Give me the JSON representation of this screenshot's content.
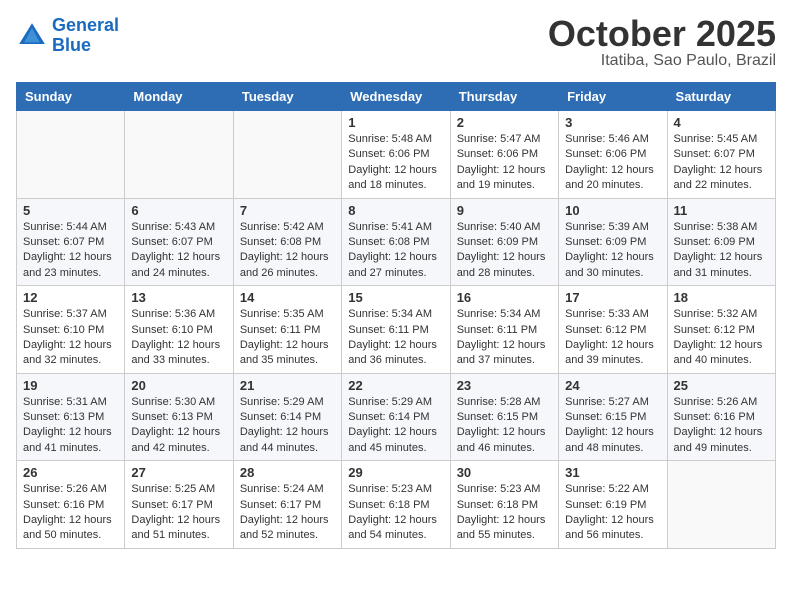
{
  "header": {
    "logo_line1": "General",
    "logo_line2": "Blue",
    "month": "October 2025",
    "location": "Itatiba, Sao Paulo, Brazil"
  },
  "weekdays": [
    "Sunday",
    "Monday",
    "Tuesday",
    "Wednesday",
    "Thursday",
    "Friday",
    "Saturday"
  ],
  "weeks": [
    [
      {
        "day": "",
        "sunrise": "",
        "sunset": "",
        "daylight": ""
      },
      {
        "day": "",
        "sunrise": "",
        "sunset": "",
        "daylight": ""
      },
      {
        "day": "",
        "sunrise": "",
        "sunset": "",
        "daylight": ""
      },
      {
        "day": "1",
        "sunrise": "Sunrise: 5:48 AM",
        "sunset": "Sunset: 6:06 PM",
        "daylight": "Daylight: 12 hours and 18 minutes."
      },
      {
        "day": "2",
        "sunrise": "Sunrise: 5:47 AM",
        "sunset": "Sunset: 6:06 PM",
        "daylight": "Daylight: 12 hours and 19 minutes."
      },
      {
        "day": "3",
        "sunrise": "Sunrise: 5:46 AM",
        "sunset": "Sunset: 6:06 PM",
        "daylight": "Daylight: 12 hours and 20 minutes."
      },
      {
        "day": "4",
        "sunrise": "Sunrise: 5:45 AM",
        "sunset": "Sunset: 6:07 PM",
        "daylight": "Daylight: 12 hours and 22 minutes."
      }
    ],
    [
      {
        "day": "5",
        "sunrise": "Sunrise: 5:44 AM",
        "sunset": "Sunset: 6:07 PM",
        "daylight": "Daylight: 12 hours and 23 minutes."
      },
      {
        "day": "6",
        "sunrise": "Sunrise: 5:43 AM",
        "sunset": "Sunset: 6:07 PM",
        "daylight": "Daylight: 12 hours and 24 minutes."
      },
      {
        "day": "7",
        "sunrise": "Sunrise: 5:42 AM",
        "sunset": "Sunset: 6:08 PM",
        "daylight": "Daylight: 12 hours and 26 minutes."
      },
      {
        "day": "8",
        "sunrise": "Sunrise: 5:41 AM",
        "sunset": "Sunset: 6:08 PM",
        "daylight": "Daylight: 12 hours and 27 minutes."
      },
      {
        "day": "9",
        "sunrise": "Sunrise: 5:40 AM",
        "sunset": "Sunset: 6:09 PM",
        "daylight": "Daylight: 12 hours and 28 minutes."
      },
      {
        "day": "10",
        "sunrise": "Sunrise: 5:39 AM",
        "sunset": "Sunset: 6:09 PM",
        "daylight": "Daylight: 12 hours and 30 minutes."
      },
      {
        "day": "11",
        "sunrise": "Sunrise: 5:38 AM",
        "sunset": "Sunset: 6:09 PM",
        "daylight": "Daylight: 12 hours and 31 minutes."
      }
    ],
    [
      {
        "day": "12",
        "sunrise": "Sunrise: 5:37 AM",
        "sunset": "Sunset: 6:10 PM",
        "daylight": "Daylight: 12 hours and 32 minutes."
      },
      {
        "day": "13",
        "sunrise": "Sunrise: 5:36 AM",
        "sunset": "Sunset: 6:10 PM",
        "daylight": "Daylight: 12 hours and 33 minutes."
      },
      {
        "day": "14",
        "sunrise": "Sunrise: 5:35 AM",
        "sunset": "Sunset: 6:11 PM",
        "daylight": "Daylight: 12 hours and 35 minutes."
      },
      {
        "day": "15",
        "sunrise": "Sunrise: 5:34 AM",
        "sunset": "Sunset: 6:11 PM",
        "daylight": "Daylight: 12 hours and 36 minutes."
      },
      {
        "day": "16",
        "sunrise": "Sunrise: 5:34 AM",
        "sunset": "Sunset: 6:11 PM",
        "daylight": "Daylight: 12 hours and 37 minutes."
      },
      {
        "day": "17",
        "sunrise": "Sunrise: 5:33 AM",
        "sunset": "Sunset: 6:12 PM",
        "daylight": "Daylight: 12 hours and 39 minutes."
      },
      {
        "day": "18",
        "sunrise": "Sunrise: 5:32 AM",
        "sunset": "Sunset: 6:12 PM",
        "daylight": "Daylight: 12 hours and 40 minutes."
      }
    ],
    [
      {
        "day": "19",
        "sunrise": "Sunrise: 5:31 AM",
        "sunset": "Sunset: 6:13 PM",
        "daylight": "Daylight: 12 hours and 41 minutes."
      },
      {
        "day": "20",
        "sunrise": "Sunrise: 5:30 AM",
        "sunset": "Sunset: 6:13 PM",
        "daylight": "Daylight: 12 hours and 42 minutes."
      },
      {
        "day": "21",
        "sunrise": "Sunrise: 5:29 AM",
        "sunset": "Sunset: 6:14 PM",
        "daylight": "Daylight: 12 hours and 44 minutes."
      },
      {
        "day": "22",
        "sunrise": "Sunrise: 5:29 AM",
        "sunset": "Sunset: 6:14 PM",
        "daylight": "Daylight: 12 hours and 45 minutes."
      },
      {
        "day": "23",
        "sunrise": "Sunrise: 5:28 AM",
        "sunset": "Sunset: 6:15 PM",
        "daylight": "Daylight: 12 hours and 46 minutes."
      },
      {
        "day": "24",
        "sunrise": "Sunrise: 5:27 AM",
        "sunset": "Sunset: 6:15 PM",
        "daylight": "Daylight: 12 hours and 48 minutes."
      },
      {
        "day": "25",
        "sunrise": "Sunrise: 5:26 AM",
        "sunset": "Sunset: 6:16 PM",
        "daylight": "Daylight: 12 hours and 49 minutes."
      }
    ],
    [
      {
        "day": "26",
        "sunrise": "Sunrise: 5:26 AM",
        "sunset": "Sunset: 6:16 PM",
        "daylight": "Daylight: 12 hours and 50 minutes."
      },
      {
        "day": "27",
        "sunrise": "Sunrise: 5:25 AM",
        "sunset": "Sunset: 6:17 PM",
        "daylight": "Daylight: 12 hours and 51 minutes."
      },
      {
        "day": "28",
        "sunrise": "Sunrise: 5:24 AM",
        "sunset": "Sunset: 6:17 PM",
        "daylight": "Daylight: 12 hours and 52 minutes."
      },
      {
        "day": "29",
        "sunrise": "Sunrise: 5:23 AM",
        "sunset": "Sunset: 6:18 PM",
        "daylight": "Daylight: 12 hours and 54 minutes."
      },
      {
        "day": "30",
        "sunrise": "Sunrise: 5:23 AM",
        "sunset": "Sunset: 6:18 PM",
        "daylight": "Daylight: 12 hours and 55 minutes."
      },
      {
        "day": "31",
        "sunrise": "Sunrise: 5:22 AM",
        "sunset": "Sunset: 6:19 PM",
        "daylight": "Daylight: 12 hours and 56 minutes."
      },
      {
        "day": "",
        "sunrise": "",
        "sunset": "",
        "daylight": ""
      }
    ]
  ]
}
